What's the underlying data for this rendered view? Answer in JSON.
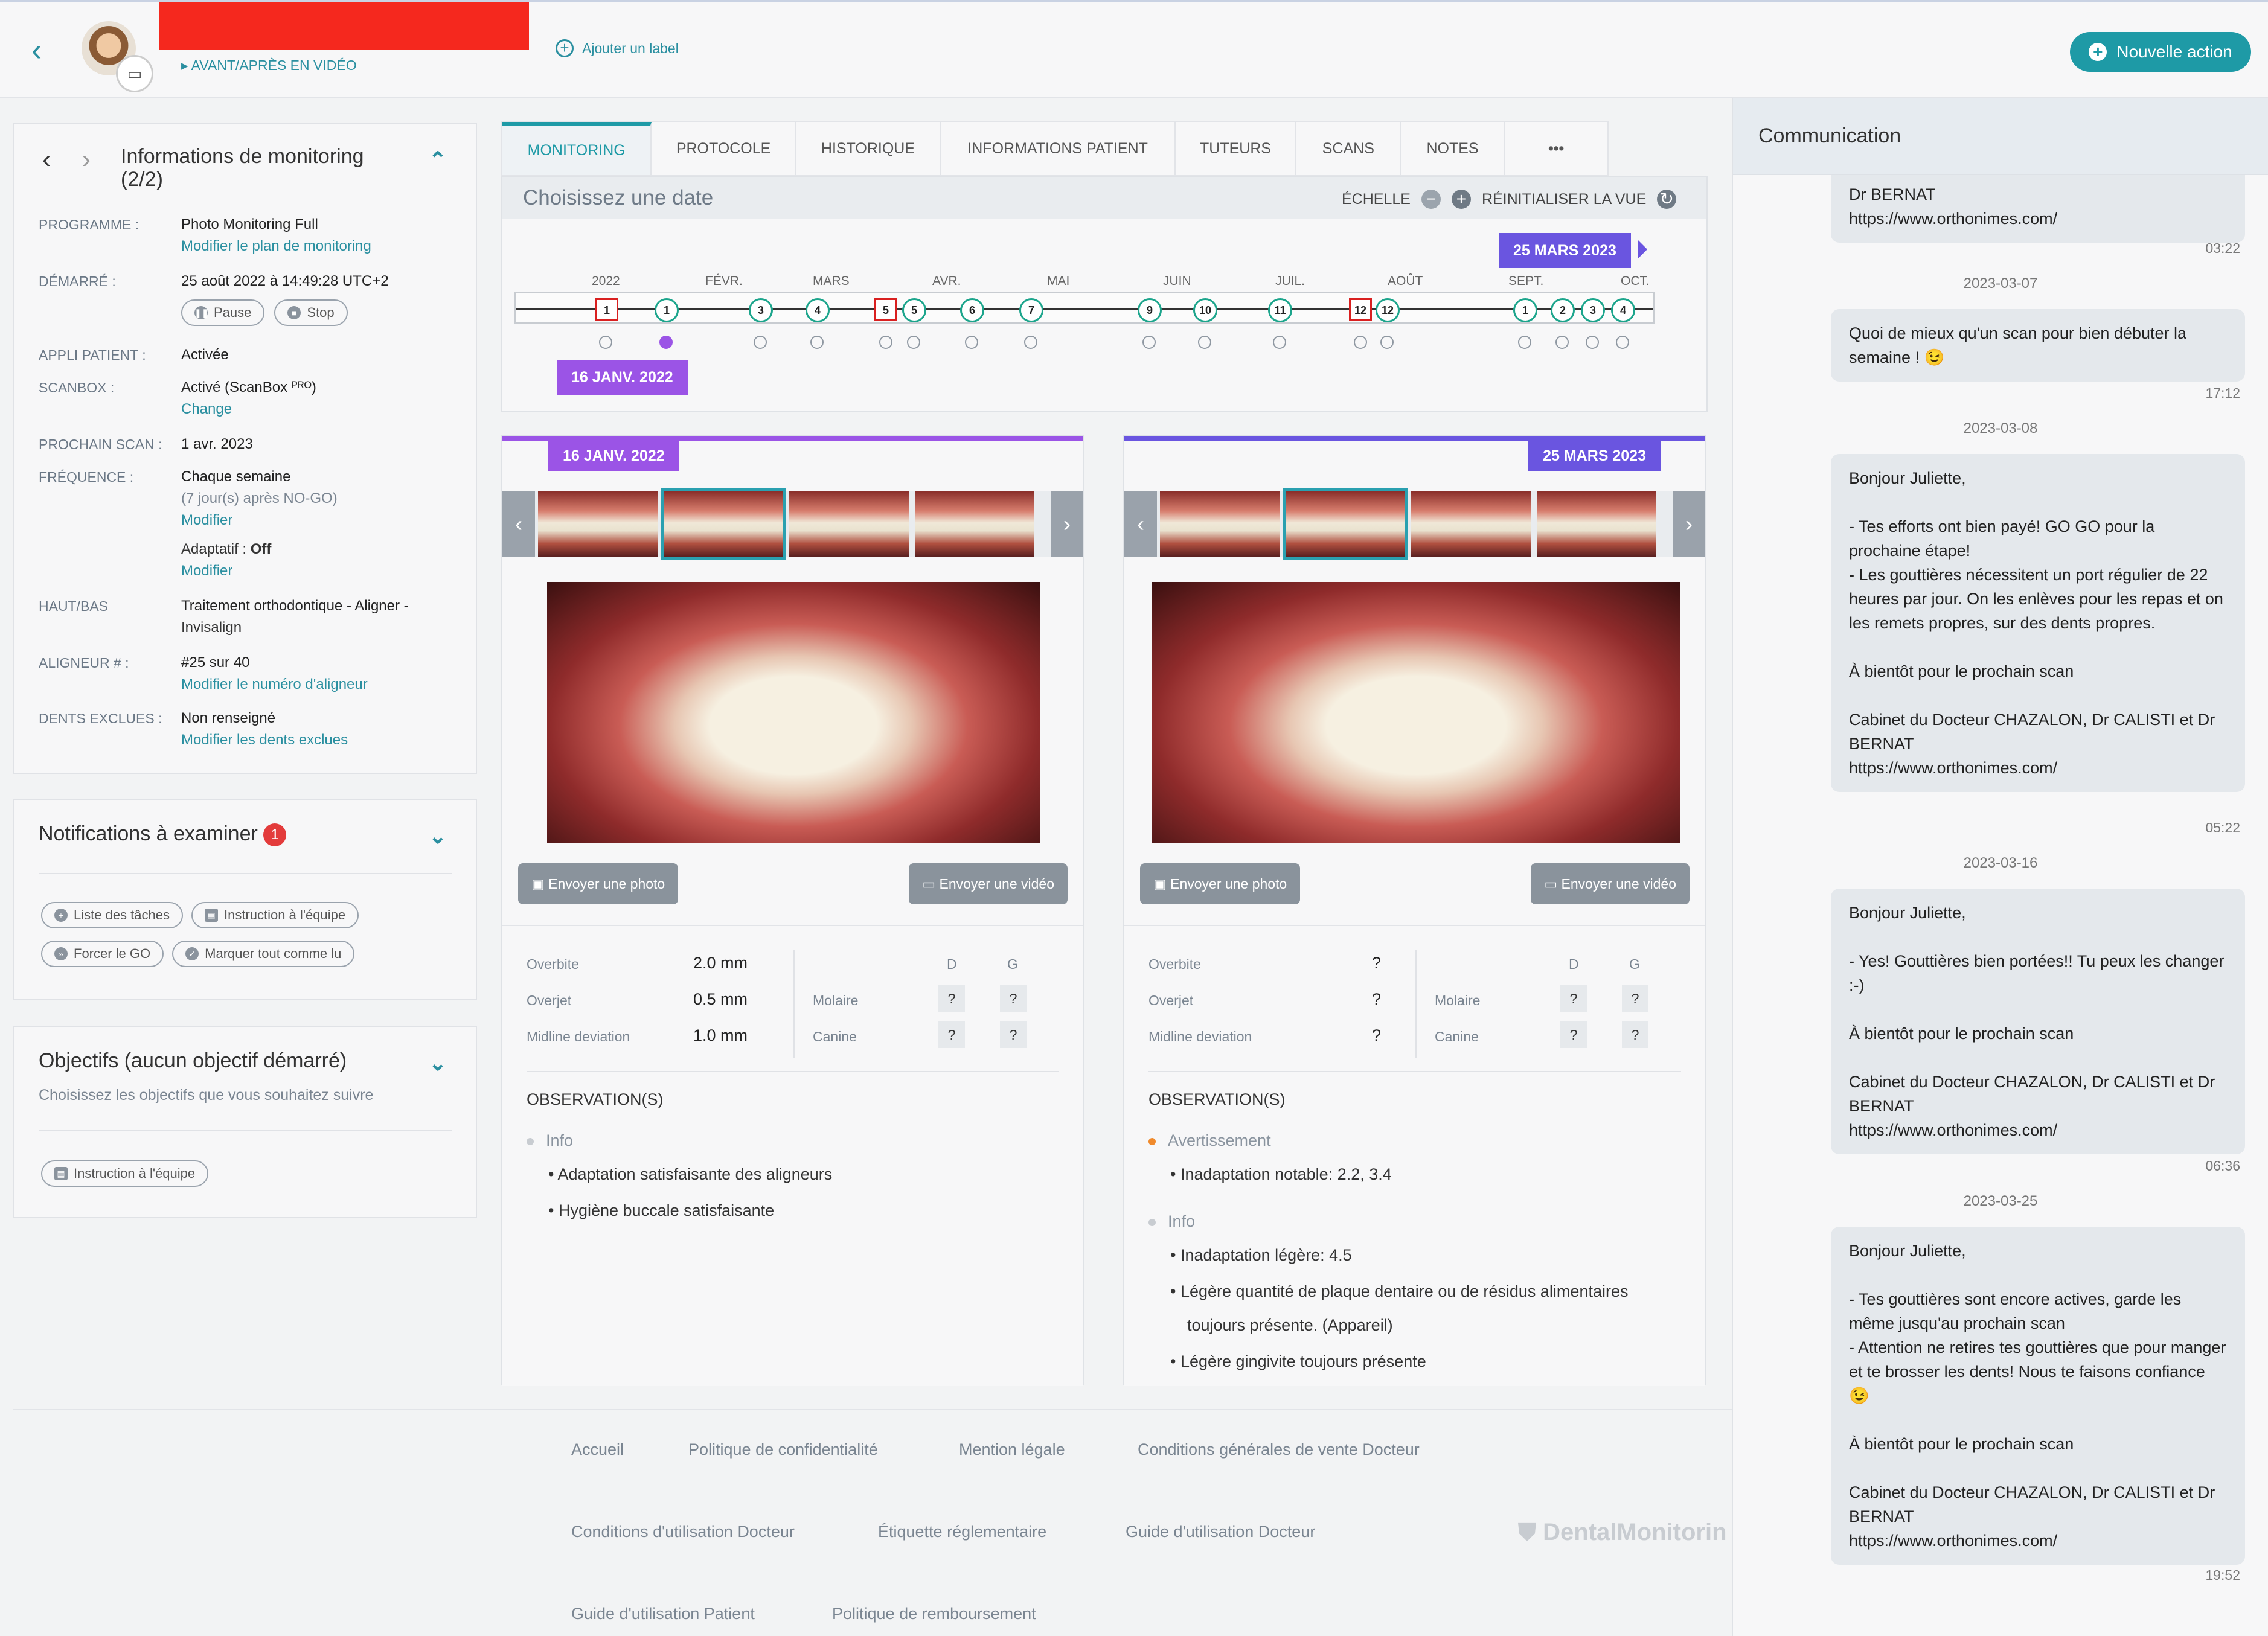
{
  "header": {
    "video_link": "▸ AVANT/APRÈS EN VIDÉO",
    "add_label": "Ajouter un label",
    "new_action": "Nouvelle action"
  },
  "monitoring": {
    "title": "Informations de monitoring (2/2)",
    "rows": [
      {
        "k": "PROGRAMME :",
        "v": "Photo Monitoring Full",
        "link": "Modifier le plan de monitoring"
      },
      {
        "k": "DÉMARRÉ :",
        "v": "25 août 2022 à 14:49:28 UTC+2",
        "pause": "Pause",
        "stop": "Stop"
      },
      {
        "k": "APPLI PATIENT :",
        "v": "Activée"
      },
      {
        "k": "SCANBOX :",
        "v": "Activé (ScanBox ᴾᴿᴼ)",
        "link": "Change"
      },
      {
        "k": "PROCHAIN SCAN :",
        "v": "1 avr. 2023"
      },
      {
        "k": "FRÉQUENCE :",
        "v": "Chaque semaine",
        "sub": "(7 jour(s) après NO-GO)",
        "link": "Modifier",
        "adapt": "Adaptatif : ",
        "adapt_v": "Off",
        "link2": "Modifier"
      },
      {
        "k": "HAUT/BAS",
        "v": "Traitement orthodontique - Aligner -",
        "v2": "Invisalign"
      },
      {
        "k": "ALIGNEUR # :",
        "v": "#25 sur 40",
        "link": "Modifier le numéro d'aligneur"
      },
      {
        "k": "DENTS EXCLUES :",
        "v": "Non renseigné",
        "link": "Modifier les dents exclues"
      }
    ]
  },
  "notifications": {
    "title": "Notifications à examiner",
    "count": "1",
    "b1": "Liste des tâches",
    "b2": "Instruction à l'équipe",
    "b3": "Forcer le GO",
    "b4": "Marquer tout comme lu"
  },
  "objectives": {
    "title": "Objectifs (aucun objectif démarré)",
    "subtitle": "Choisissez les objectifs que vous souhaitez suivre",
    "btn": "Instruction à l'équipe"
  },
  "tabs": [
    "MONITORING",
    "PROTOCOLE",
    "HISTORIQUE",
    "INFORMATIONS PATIENT",
    "TUTEURS",
    "SCANS",
    "NOTES",
    "•••"
  ],
  "datebox": {
    "title": "Choisissez une date",
    "scale": "ÉCHELLE",
    "reset": "RÉINITIALISER LA VUE",
    "chip_top": "25 MARS 2023",
    "chip_bottom": "16 JANV. 2022",
    "months": [
      "2022",
      "FÉVR.",
      "MARS",
      "AVR.",
      "MAI",
      "JUIN",
      "JUIL.",
      "AOÛT",
      "SEPT.",
      "OCT."
    ],
    "nodes": [
      "1",
      "1",
      "3",
      "4",
      "5",
      "5",
      "6",
      "7",
      "9",
      "10",
      "11",
      "12",
      "12",
      "1",
      "2",
      "3",
      "4"
    ]
  },
  "left": {
    "date": "16 JANV. 2022",
    "send_photo": "Envoyer une photo",
    "send_video": "Envoyer une vidéo",
    "overbite": "Overbite",
    "overbite_v": "2.0 mm",
    "overjet": "Overjet",
    "overjet_v": "0.5 mm",
    "midline": "Midline deviation",
    "midline_v": "1.0 mm",
    "d": "D",
    "g": "G",
    "molaire": "Molaire",
    "canine": "Canine",
    "q": "?",
    "obs_title": "OBSERVATION(S)",
    "cat1": "Info",
    "items1": [
      "Adaptation satisfaisante des aligneurs",
      "Hygiène buccale satisfaisante"
    ]
  },
  "right": {
    "date": "25 MARS 2023",
    "send_photo": "Envoyer une photo",
    "send_video": "Envoyer une vidéo",
    "overbite": "Overbite",
    "overjet": "Overjet",
    "midline": "Midline deviation",
    "q": "?",
    "d": "D",
    "g": "G",
    "molaire": "Molaire",
    "canine": "Canine",
    "obs_title": "OBSERVATION(S)",
    "cat1": "Avertissement",
    "items1": [
      "Inadaptation notable: 2.2, 3.4"
    ],
    "cat2": "Info",
    "items2": [
      "Inadaptation légère: 4.5",
      "Légère quantité de plaque dentaire ou de résidus alimentaires",
      "toujours présente. (Appareil)",
      "Légère gingivite toujours présente"
    ]
  },
  "footer": {
    "l1": "Accueil",
    "l2": "Politique de confidentialité",
    "l3": "Mention légale",
    "l4": "Conditions générales de vente Docteur",
    "l5": "Conditions d'utilisation Docteur",
    "l6": "Étiquette réglementaire",
    "l7": "Guide d'utilisation Docteur",
    "l8": "Guide d'utilisation Patient",
    "l9": "Politique de remboursement",
    "brand": "DentalMonitorin"
  },
  "communication": {
    "title": "Communication",
    "m0": "Dr BERNAT\nhttps://www.orthonimes.com/",
    "t0": "03:22",
    "d1": "2023-03-07",
    "m1": "Quoi de mieux qu'un scan pour bien débuter la semaine ! 😉",
    "t1": "17:12",
    "d2": "2023-03-08",
    "m2": "Bonjour Juliette,\n\n- Tes efforts ont bien payé! GO GO pour la prochaine étape!\n- Les gouttières nécessitent un port régulier de 22 heures par jour. On les enlèves pour les repas et on les remets propres, sur des dents propres.\n\nÀ bientôt pour le prochain scan\n\nCabinet du Docteur CHAZALON, Dr CALISTI et Dr BERNAT\nhttps://www.orthonimes.com/",
    "t2": "05:22",
    "d3": "2023-03-16",
    "m3": "Bonjour Juliette,\n\n- Yes! Gouttières bien portées!! Tu peux les changer :-)\n\nÀ bientôt pour le prochain scan\n\nCabinet du Docteur CHAZALON, Dr CALISTI et Dr BERNAT\nhttps://www.orthonimes.com/",
    "t3": "06:36",
    "d4": "2023-03-25",
    "m4": "Bonjour Juliette,\n\n- Tes gouttières sont encore actives, garde les même jusqu'au prochain scan\n- Attention ne retires tes gouttières que pour manger et te brosser les dents! Nous te faisons confiance 😉\n\nÀ bientôt pour le prochain scan\n\nCabinet du Docteur CHAZALON, Dr CALISTI et Dr BERNAT\nhttps://www.orthonimes.com/",
    "t4": "19:52"
  }
}
